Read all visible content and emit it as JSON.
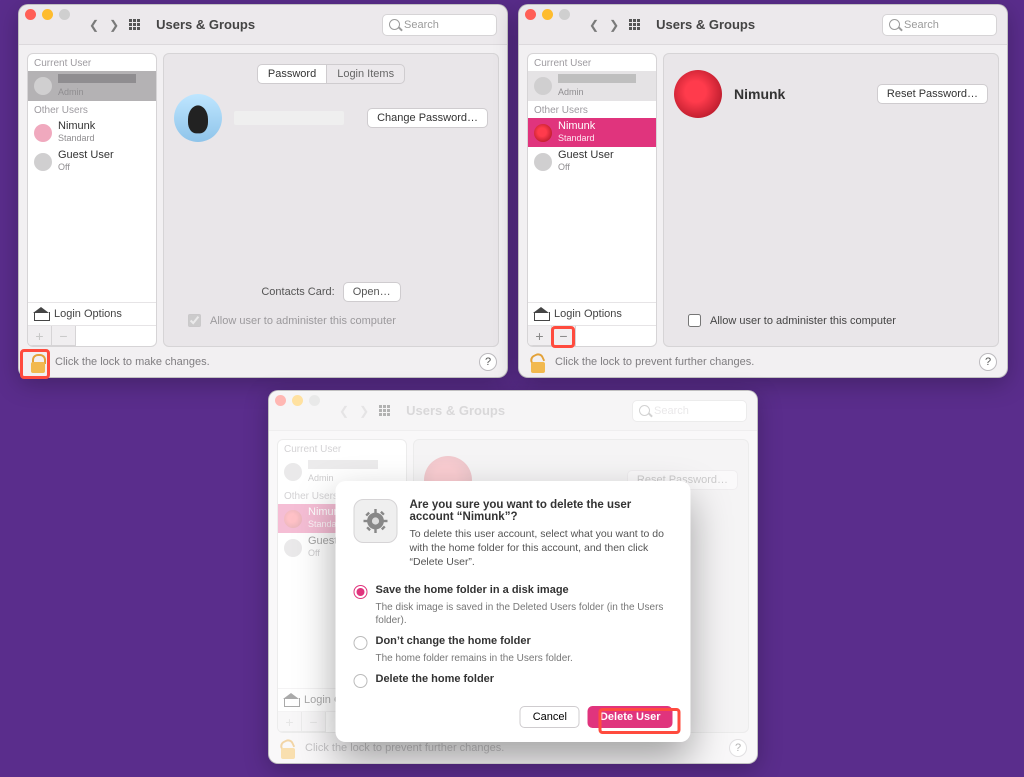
{
  "shared": {
    "title": "Users & Groups",
    "search_placeholder": "Search",
    "section_current": "Current User",
    "section_other": "Other Users",
    "login_options_label": "Login Options",
    "admin_check_label": "Allow user to administer this computer",
    "help_glyph": "?"
  },
  "panel1": {
    "current_user_name": "",
    "current_user_role": "Admin",
    "other_users": [
      {
        "name": "Nimunk",
        "role": "Standard"
      },
      {
        "name": "Guest User",
        "role": "Off"
      }
    ],
    "tabs": {
      "password": "Password",
      "login_items": "Login Items"
    },
    "change_pw_btn": "Change Password…",
    "contacts_label": "Contacts Card:",
    "contacts_open_btn": "Open…",
    "lock_msg": "Click the lock to make changes.",
    "plus": "+",
    "minus": "−"
  },
  "panel2": {
    "current_user_name": "",
    "current_user_role": "Admin",
    "other_users": [
      {
        "name": "Nimunk",
        "role": "Standard"
      },
      {
        "name": "Guest User",
        "role": "Off"
      }
    ],
    "detail_name": "Nimunk",
    "reset_pw_btn": "Reset Password…",
    "lock_msg": "Click the lock to prevent further changes.",
    "plus": "+",
    "minus": "−"
  },
  "panel3": {
    "current_user_name": "",
    "current_user_role": "Admin",
    "other_users": [
      {
        "name": "Nimunk",
        "role": "Standard"
      },
      {
        "name": "Guest User",
        "role": "Off"
      }
    ],
    "reset_pw_btn": "Reset Password…",
    "lock_msg": "Click the lock to prevent further changes.",
    "plus": "+",
    "minus": "−",
    "sheet": {
      "heading": "Are you sure you want to delete the user account “Nimunk”?",
      "desc": "To delete this user account, select what you want to do with the home folder for this account, and then click “Delete User”.",
      "opt1": "Save the home folder in a disk image",
      "opt1_sub": "The disk image is saved in the Deleted Users folder (in the Users folder).",
      "opt2": "Don’t change the home folder",
      "opt2_sub": "The home folder remains in the Users folder.",
      "opt3": "Delete the home folder",
      "cancel": "Cancel",
      "delete": "Delete User"
    }
  }
}
